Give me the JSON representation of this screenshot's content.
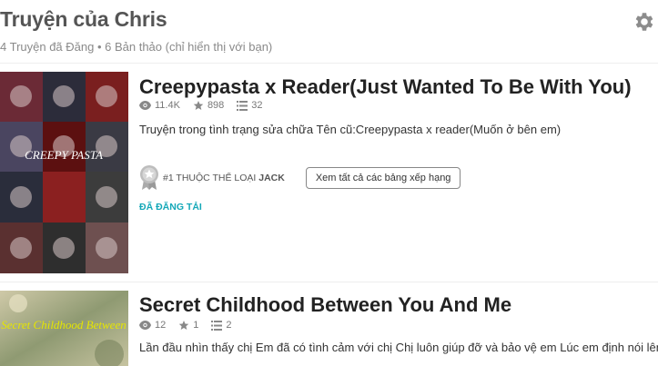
{
  "header": {
    "title": "Truyện của Chris",
    "subtitle": "4 Truyện đã Đăng • 6 Bản thảo (chỉ hiển thị với bạn)",
    "settings_icon": "gear-icon"
  },
  "stories": [
    {
      "title": "Creepypasta x Reader(Just Wanted To Be With You)",
      "reads": "11.4K",
      "votes": "898",
      "parts": "32",
      "description": "Truyện trong tình trạng sửa chữa Tên cũ:Creepypasta x reader(Muốn ở bên em)",
      "rank_prefix": "#1 THUỘC THỂ LOẠI",
      "rank_tag": "JACK",
      "rank_button": "Xem tất cả các bảng xếp hạng",
      "status": "ĐÃ ĐĂNG TẢI",
      "cover_text": "CREEPY PASTA"
    },
    {
      "title": "Secret Childhood Between You And Me",
      "reads": "12",
      "votes": "1",
      "parts": "2",
      "description": "Lần đầu nhìn thấy chị Em đã có tình cảm với chị Chị luôn giúp đỡ và bảo vệ em Lúc em định nói lên tình cảm của mình thì... Em phát hiện... Chị là người chị cùng mẹ khác cha của em",
      "cover_text": "Secret Childhood Between"
    }
  ],
  "colors": {
    "accent": "#14a8b8",
    "title": "#222222",
    "muted": "#8a8a8a"
  }
}
